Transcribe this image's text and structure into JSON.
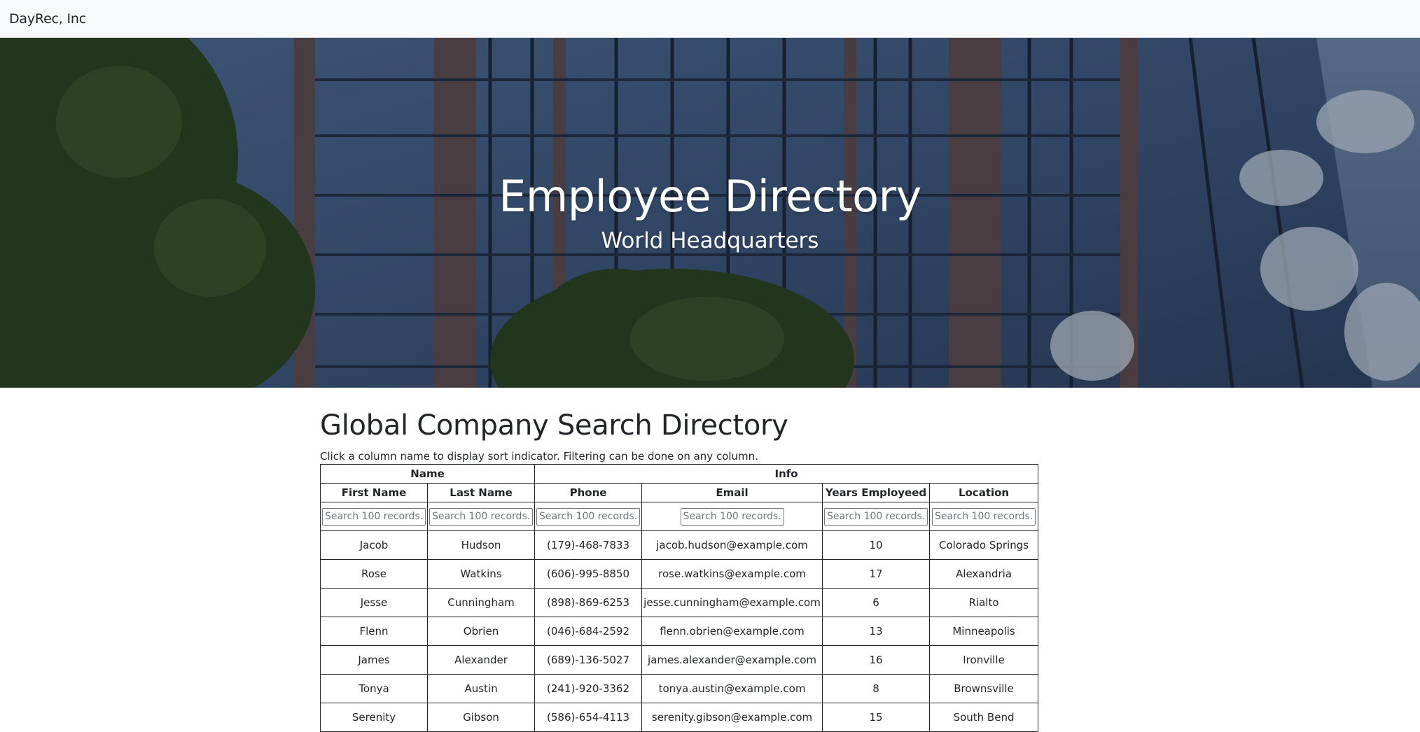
{
  "navbar": {
    "brand": "DayRec, Inc"
  },
  "hero": {
    "title": "Employee Directory",
    "subtitle": "World Headquarters"
  },
  "main": {
    "title": "Global Company Search Directory",
    "hint": "Click a column name to display sort indicator. Filtering can be done on any column."
  },
  "table": {
    "groups": [
      {
        "label": "Name",
        "span": 2
      },
      {
        "label": "Info",
        "span": 4
      }
    ],
    "columns": [
      "First Name",
      "Last Name",
      "Phone",
      "Email",
      "Years Employeed",
      "Location"
    ],
    "filter_placeholder": "Search 100 records...",
    "rows": [
      [
        "Jacob",
        "Hudson",
        "(179)-468-7833",
        "jacob.hudson@example.com",
        "10",
        "Colorado Springs"
      ],
      [
        "Rose",
        "Watkins",
        "(606)-995-8850",
        "rose.watkins@example.com",
        "17",
        "Alexandria"
      ],
      [
        "Jesse",
        "Cunningham",
        "(898)-869-6253",
        "jesse.cunningham@example.com",
        "6",
        "Rialto"
      ],
      [
        "Flenn",
        "Obrien",
        "(046)-684-2592",
        "flenn.obrien@example.com",
        "13",
        "Minneapolis"
      ],
      [
        "James",
        "Alexander",
        "(689)-136-5027",
        "james.alexander@example.com",
        "16",
        "Ironville"
      ],
      [
        "Tonya",
        "Austin",
        "(241)-920-3362",
        "tonya.austin@example.com",
        "8",
        "Brownsville"
      ],
      [
        "Serenity",
        "Gibson",
        "(586)-654-4113",
        "serenity.gibson@example.com",
        "15",
        "South Bend"
      ]
    ]
  }
}
